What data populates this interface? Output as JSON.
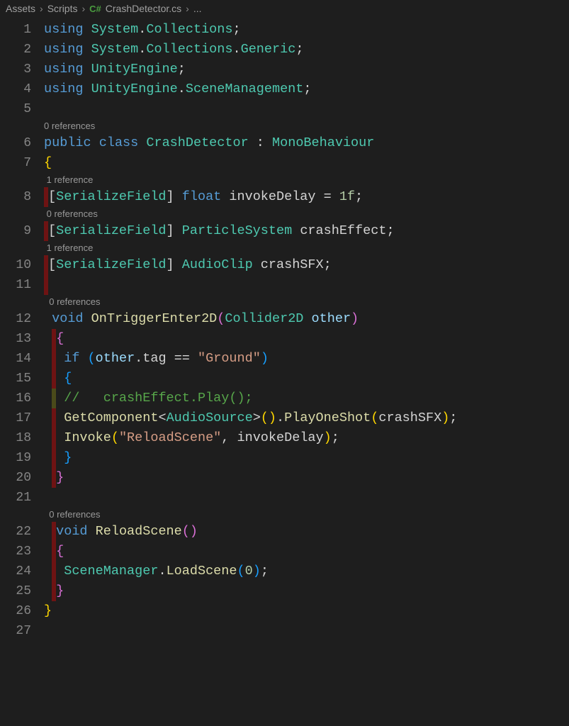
{
  "breadcrumb": {
    "parts": [
      "Assets",
      "Scripts",
      "CrashDetector.cs",
      "..."
    ],
    "icon_label": "C#"
  },
  "codelens": {
    "ref0": "0 references",
    "ref1": "1 reference"
  },
  "tokens": {
    "using": "using",
    "public": "public",
    "class": "class",
    "void": "void",
    "float": "float",
    "if": "if",
    "System": "System",
    "Collections": "Collections",
    "Generic": "Generic",
    "UnityEngine": "UnityEngine",
    "SceneManagement": "SceneManagement",
    "CrashDetector": "CrashDetector",
    "MonoBehaviour": "MonoBehaviour",
    "SerializeField": "SerializeField",
    "invokeDelay": "invokeDelay",
    "ParticleSystem": "ParticleSystem",
    "crashEffect": "crashEffect",
    "AudioClip": "AudioClip",
    "crashSFX": "crashSFX",
    "OnTriggerEnter2D": "OnTriggerEnter2D",
    "Collider2D": "Collider2D",
    "other": "other",
    "tag": "tag",
    "Ground": "\"Ground\"",
    "commentLine": "//   crashEffect.Play();",
    "GetComponent": "GetComponent",
    "AudioSource": "AudioSource",
    "PlayOneShot": "PlayOneShot",
    "Invoke": "Invoke",
    "ReloadSceneStr": "\"ReloadScene\"",
    "ReloadScene": "ReloadScene",
    "SceneManager": "SceneManager",
    "LoadScene": "LoadScene",
    "oneF": "1f",
    "zero": "0",
    "eq": " = ",
    "eqeq": " == "
  },
  "lines": [
    "1",
    "2",
    "3",
    "4",
    "5",
    "6",
    "7",
    "8",
    "9",
    "10",
    "11",
    "12",
    "13",
    "14",
    "15",
    "16",
    "17",
    "18",
    "19",
    "20",
    "21",
    "22",
    "23",
    "24",
    "25",
    "26",
    "27"
  ]
}
